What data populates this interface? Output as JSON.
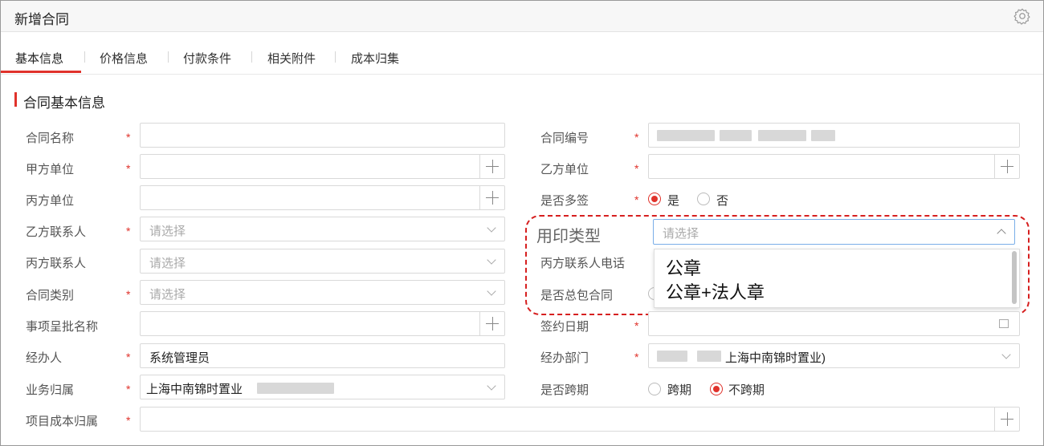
{
  "window": {
    "title": "新增合同"
  },
  "tabs": [
    {
      "label": "基本信息"
    },
    {
      "label": "价格信息"
    },
    {
      "label": "付款条件"
    },
    {
      "label": "相关附件"
    },
    {
      "label": "成本归集"
    }
  ],
  "section": {
    "title": "合同基本信息"
  },
  "required_mark": "*",
  "left_fields": {
    "contract_name": {
      "label": "合同名称",
      "value": ""
    },
    "party_a": {
      "label": "甲方单位",
      "value": ""
    },
    "party_c": {
      "label": "丙方单位",
      "value": ""
    },
    "party_b_contact": {
      "label": "乙方联系人",
      "placeholder": "请选择"
    },
    "party_c_contact": {
      "label": "丙方联系人",
      "placeholder": "请选择"
    },
    "contract_type": {
      "label": "合同类别",
      "placeholder": "请选择"
    },
    "approval_name": {
      "label": "事项呈批名称",
      "value": ""
    },
    "handler": {
      "label": "经办人",
      "value": "系统管理员"
    },
    "business_unit": {
      "label": "业务归属",
      "value": "上海中南锦时置业"
    },
    "project_cost": {
      "label": "项目成本归属",
      "value": ""
    }
  },
  "right_fields": {
    "contract_no": {
      "label": "合同编号"
    },
    "party_b": {
      "label": "乙方单位",
      "value": ""
    },
    "multi_sign": {
      "label": "是否多签",
      "options": [
        "是",
        "否"
      ],
      "selected": "是"
    },
    "seal_type": {
      "label": "用印类型",
      "placeholder": "请选择",
      "options": [
        "公章",
        "公章+法人章"
      ]
    },
    "party_c_phone": {
      "label": "丙方联系人电话"
    },
    "general_contract": {
      "label": "是否总包合同"
    },
    "sign_date": {
      "label": "签约日期",
      "value": ""
    },
    "dept": {
      "label": "经办部门",
      "value": "上海中南锦时置业)"
    },
    "cross_period": {
      "label": "是否跨期",
      "options": [
        "跨期",
        "不跨期"
      ],
      "selected": "不跨期"
    }
  },
  "colors": {
    "accent": "#e0322b",
    "callout": "#d61f1f"
  },
  "icons": {
    "settings": "gear-icon",
    "add": "plus-icon",
    "dropdown": "chevron-down-icon",
    "calendar": "calendar-icon"
  }
}
